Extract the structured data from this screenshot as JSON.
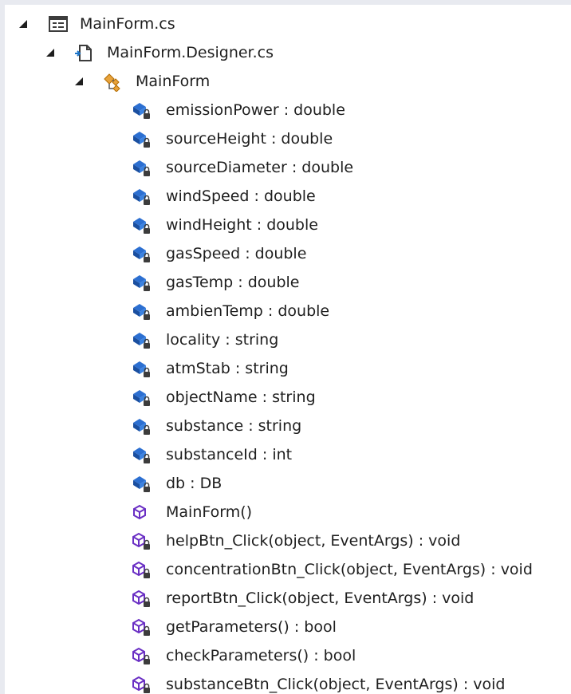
{
  "tree": {
    "file": {
      "label": "MainForm.cs",
      "icon": "form-file-icon"
    },
    "designer": {
      "label": "MainForm.Designer.cs",
      "icon": "designer-file-icon"
    },
    "class": {
      "label": "MainForm",
      "icon": "class-icon"
    },
    "members": [
      {
        "label": "emissionPower : double",
        "icon": "private-field-icon"
      },
      {
        "label": "sourceHeight : double",
        "icon": "private-field-icon"
      },
      {
        "label": "sourceDiameter : double",
        "icon": "private-field-icon"
      },
      {
        "label": "windSpeed : double",
        "icon": "private-field-icon"
      },
      {
        "label": "windHeight : double",
        "icon": "private-field-icon"
      },
      {
        "label": "gasSpeed : double",
        "icon": "private-field-icon"
      },
      {
        "label": "gasTemp : double",
        "icon": "private-field-icon"
      },
      {
        "label": "ambienTemp : double",
        "icon": "private-field-icon"
      },
      {
        "label": "locality : string",
        "icon": "private-field-icon"
      },
      {
        "label": "atmStab : string",
        "icon": "private-field-icon"
      },
      {
        "label": "objectName : string",
        "icon": "private-field-icon"
      },
      {
        "label": "substance : string",
        "icon": "private-field-icon"
      },
      {
        "label": "substanceId : int",
        "icon": "private-field-icon"
      },
      {
        "label": "db : DB",
        "icon": "private-field-icon"
      },
      {
        "label": "MainForm()",
        "icon": "public-method-icon"
      },
      {
        "label": "helpBtn_Click(object, EventArgs) : void",
        "icon": "private-method-icon"
      },
      {
        "label": "concentrationBtn_Click(object, EventArgs) : void",
        "icon": "private-method-icon"
      },
      {
        "label": "reportBtn_Click(object, EventArgs) : void",
        "icon": "private-method-icon"
      },
      {
        "label": "getParameters() : bool",
        "icon": "private-method-icon"
      },
      {
        "label": "checkParameters() : bool",
        "icon": "private-method-icon"
      },
      {
        "label": "substanceBtn_Click(object, EventArgs) : void",
        "icon": "private-method-icon"
      }
    ]
  }
}
